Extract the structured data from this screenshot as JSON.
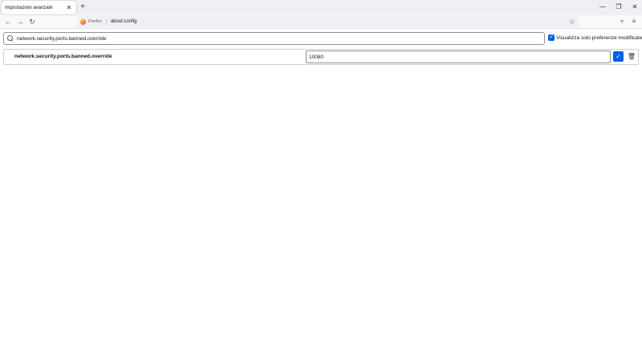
{
  "tab": {
    "title": "Impostazioni avanzate",
    "close_glyph": "✕"
  },
  "new_tab_glyph": "+",
  "window_controls": {
    "minimize": "—",
    "restore": "❐",
    "close": "✕"
  },
  "nav": {
    "back": "←",
    "forward": "→",
    "reload": "↻"
  },
  "urlbar": {
    "identity_label": "Firefox",
    "url": "about:config",
    "bookmark_glyph": "☆"
  },
  "toolbar": {
    "pocket_glyph": "▿",
    "menu_glyph": "≡"
  },
  "search": {
    "value": "network.security.ports.banned.override",
    "placeholder": ""
  },
  "show_modified": {
    "checked": true,
    "label": "Visualizza solo preferenze modificate",
    "check_glyph": "✓"
  },
  "preference": {
    "name": "network.security.ports.banned.override",
    "value": "10080",
    "save_glyph": "✓",
    "delete_glyph": "🗑"
  },
  "colors": {
    "accent": "#0061e0",
    "tabstrip_bg": "#f0f0f4",
    "navbar_bg": "#f9f9fb"
  }
}
